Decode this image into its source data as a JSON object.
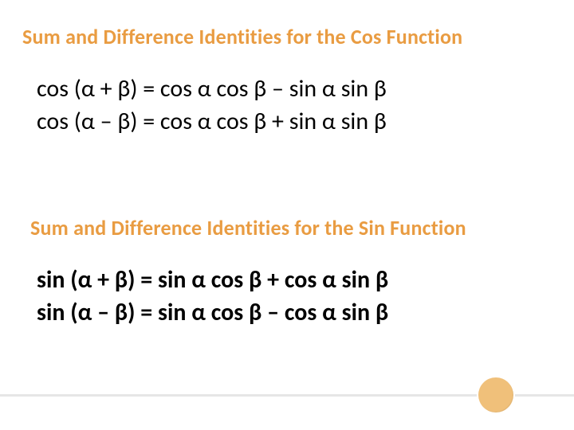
{
  "headings": {
    "cos": "Sum and Difference Identities for the Cos Function",
    "sin": "Sum and Difference Identities for the Sin Function"
  },
  "greek": {
    "alpha": "α",
    "beta": "β"
  },
  "formulas": {
    "cos_sum": "cos (α + β) = cos α cos β – sin α sin β",
    "cos_diff": "cos (α – β) = cos α cos β + sin α sin β",
    "sin_sum": "sin (α + β) = sin α cos β + cos α sin β",
    "sin_diff": "sin (α – β) = sin α cos β – cos α sin β"
  },
  "colors": {
    "heading": "#e99c42",
    "text": "#000000",
    "accent_line": "#e6e6e6",
    "accent_circle": "#f0c07a"
  }
}
